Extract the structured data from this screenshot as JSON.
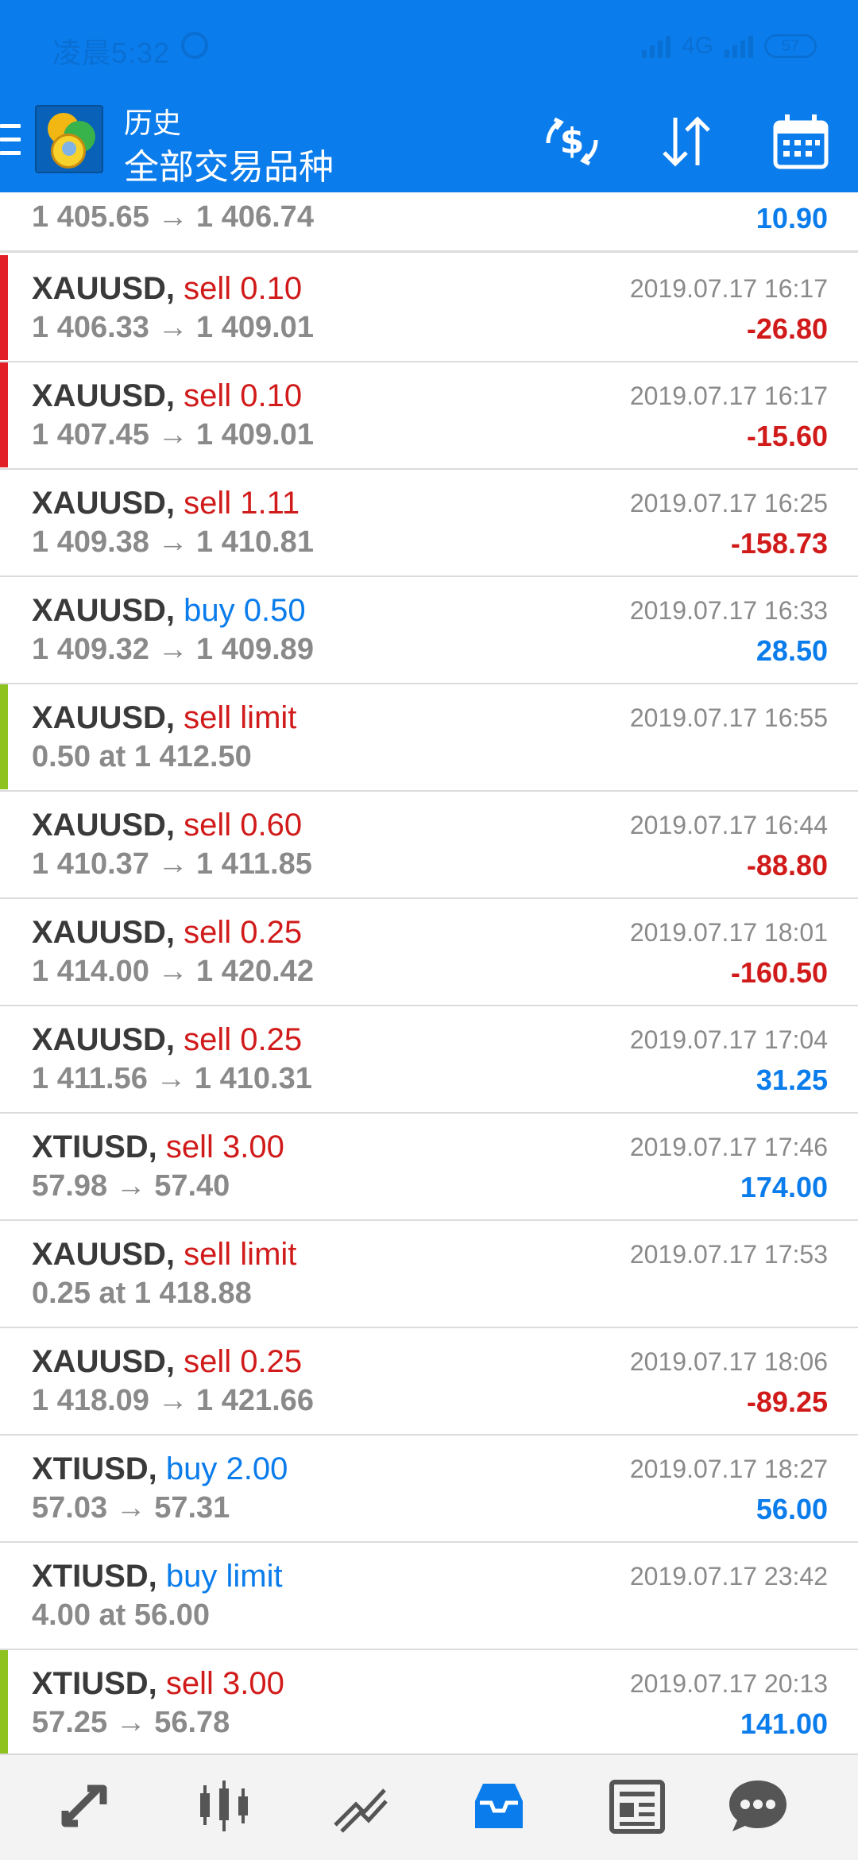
{
  "status_bar": {
    "time": "凌晨5:32",
    "network": "4G",
    "battery": "57"
  },
  "header": {
    "title": "历史",
    "subtitle": "全部交易品种"
  },
  "colors": {
    "sell": "#d11a1a",
    "buy": "#0b7ceb",
    "loss": "#d11a1a",
    "profit": "#0b7ceb",
    "stripe_red": "#e21f26",
    "stripe_green": "#8ec21f",
    "header_bg": "#0b7ceb"
  },
  "icons": {
    "toolbar": [
      "menu-icon",
      "app-logo-icon",
      "currency-exchange-icon",
      "sort-icon",
      "calendar-icon"
    ],
    "nav": [
      "quotes-icon",
      "chart-icon",
      "trade-icon",
      "history-icon",
      "news-icon",
      "chat-icon"
    ]
  },
  "partial_row": {
    "prices": "1 405.65 → 1 406.74",
    "profit": "10.90",
    "profit_dir": "profit"
  },
  "rows": [
    {
      "symbol": "XAUUSD,",
      "deal": "sell 0.10",
      "dir": "sell",
      "prices": "1 406.33 → 1 409.01",
      "time": "2019.07.17 16:17",
      "profit": "-26.80",
      "profit_dir": "loss",
      "stripe": "red"
    },
    {
      "symbol": "XAUUSD,",
      "deal": "sell 0.10",
      "dir": "sell",
      "prices": "1 407.45 → 1 409.01",
      "time": "2019.07.17 16:17",
      "profit": "-15.60",
      "profit_dir": "loss",
      "stripe": "red"
    },
    {
      "symbol": "XAUUSD,",
      "deal": "sell 1.11",
      "dir": "sell",
      "prices": "1 409.38 → 1 410.81",
      "time": "2019.07.17 16:25",
      "profit": "-158.73",
      "profit_dir": "loss",
      "stripe": ""
    },
    {
      "symbol": "XAUUSD,",
      "deal": "buy 0.50",
      "dir": "buy",
      "prices": "1 409.32 → 1 409.89",
      "time": "2019.07.17 16:33",
      "profit": "28.50",
      "profit_dir": "profit",
      "stripe": ""
    },
    {
      "symbol": "XAUUSD,",
      "deal": "sell limit",
      "dir": "sell",
      "prices": "0.50 at 1 412.50",
      "time": "2019.07.17 16:55",
      "profit": "",
      "profit_dir": "",
      "stripe": "green"
    },
    {
      "symbol": "XAUUSD,",
      "deal": "sell 0.60",
      "dir": "sell",
      "prices": "1 410.37 → 1 411.85",
      "time": "2019.07.17 16:44",
      "profit": "-88.80",
      "profit_dir": "loss",
      "stripe": ""
    },
    {
      "symbol": "XAUUSD,",
      "deal": "sell 0.25",
      "dir": "sell",
      "prices": "1 414.00 → 1 420.42",
      "time": "2019.07.17 18:01",
      "profit": "-160.50",
      "profit_dir": "loss",
      "stripe": ""
    },
    {
      "symbol": "XAUUSD,",
      "deal": "sell 0.25",
      "dir": "sell",
      "prices": "1 411.56 → 1 410.31",
      "time": "2019.07.17 17:04",
      "profit": "31.25",
      "profit_dir": "profit",
      "stripe": ""
    },
    {
      "symbol": "XTIUSD,",
      "deal": "sell 3.00",
      "dir": "sell",
      "prices": "57.98 → 57.40",
      "time": "2019.07.17 17:46",
      "profit": "174.00",
      "profit_dir": "profit",
      "stripe": ""
    },
    {
      "symbol": "XAUUSD,",
      "deal": "sell limit",
      "dir": "sell",
      "prices": "0.25 at 1 418.88",
      "time": "2019.07.17 17:53",
      "profit": "",
      "profit_dir": "",
      "stripe": ""
    },
    {
      "symbol": "XAUUSD,",
      "deal": "sell 0.25",
      "dir": "sell",
      "prices": "1 418.09 → 1 421.66",
      "time": "2019.07.17 18:06",
      "profit": "-89.25",
      "profit_dir": "loss",
      "stripe": ""
    },
    {
      "symbol": "XTIUSD,",
      "deal": "buy 2.00",
      "dir": "buy",
      "prices": "57.03 → 57.31",
      "time": "2019.07.17 18:27",
      "profit": "56.00",
      "profit_dir": "profit",
      "stripe": ""
    },
    {
      "symbol": "XTIUSD,",
      "deal": "buy limit",
      "dir": "buy",
      "prices": "4.00 at 56.00",
      "time": "2019.07.17 23:42",
      "profit": "",
      "profit_dir": "",
      "stripe": ""
    },
    {
      "symbol": "XTIUSD,",
      "deal": "sell 3.00",
      "dir": "sell",
      "prices": "57.25 → 56.78",
      "time": "2019.07.17 20:13",
      "profit": "141.00",
      "profit_dir": "profit",
      "stripe": "green"
    }
  ],
  "active_nav": 3
}
